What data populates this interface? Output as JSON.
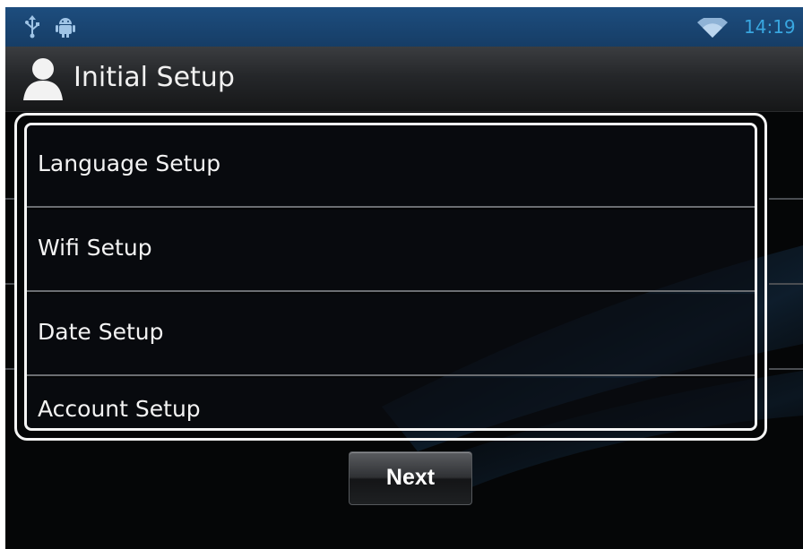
{
  "status_bar": {
    "time": "14:19",
    "icons": [
      "usb-icon",
      "android-debug-icon",
      "wifi-icon"
    ]
  },
  "header": {
    "title": "Initial Setup",
    "icon": "user-icon"
  },
  "settings": {
    "items": [
      {
        "label": "Language Setup"
      },
      {
        "label": "Wifi Setup"
      },
      {
        "label": "Date Setup"
      },
      {
        "label": "Account Setup"
      }
    ]
  },
  "actions": {
    "next_label": "Next"
  },
  "colors": {
    "status_bar": "#1a4574",
    "clock": "#39a7e0",
    "background": "#050607",
    "frame": "#f4f4f4"
  }
}
